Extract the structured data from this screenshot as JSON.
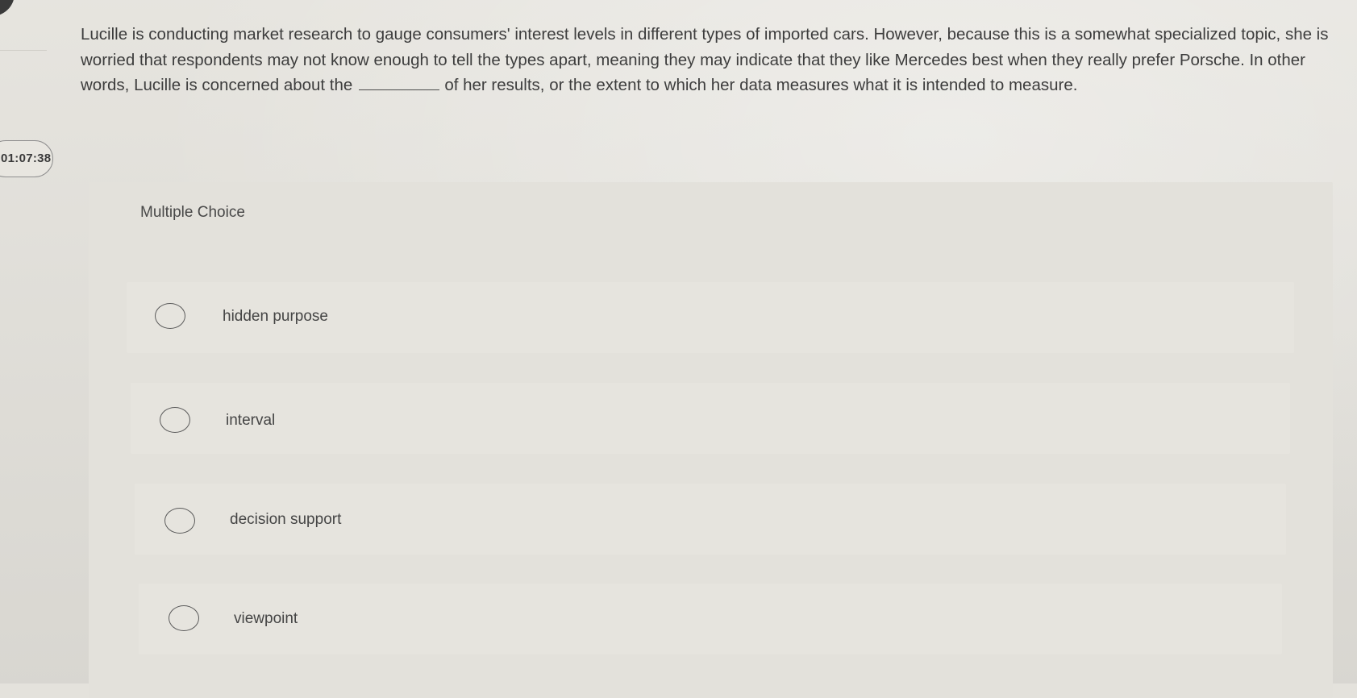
{
  "timer": "01:07:38",
  "question": {
    "before_blank": "Lucille is conducting market research to gauge consumers' interest levels in different types of imported cars. However, because this is a somewhat specialized topic, she is worried that respondents may not know enough to tell the types apart, meaning they may indicate that they like Mercedes best when they really prefer Porsche. In other words, Lucille is concerned about the",
    "after_blank": "of her results, or the extent to which her data measures what it is intended to measure."
  },
  "question_type": "Multiple Choice",
  "options": [
    {
      "label": "hidden purpose",
      "selected": false
    },
    {
      "label": "interval",
      "selected": false
    },
    {
      "label": "decision support",
      "selected": false
    },
    {
      "label": "viewpoint",
      "selected": false
    }
  ],
  "icons": {
    "nav": "back-circle-icon",
    "radio": "radio-empty-icon"
  },
  "colors": {
    "background": "#e4e2dc",
    "text": "#3d3d3d"
  }
}
